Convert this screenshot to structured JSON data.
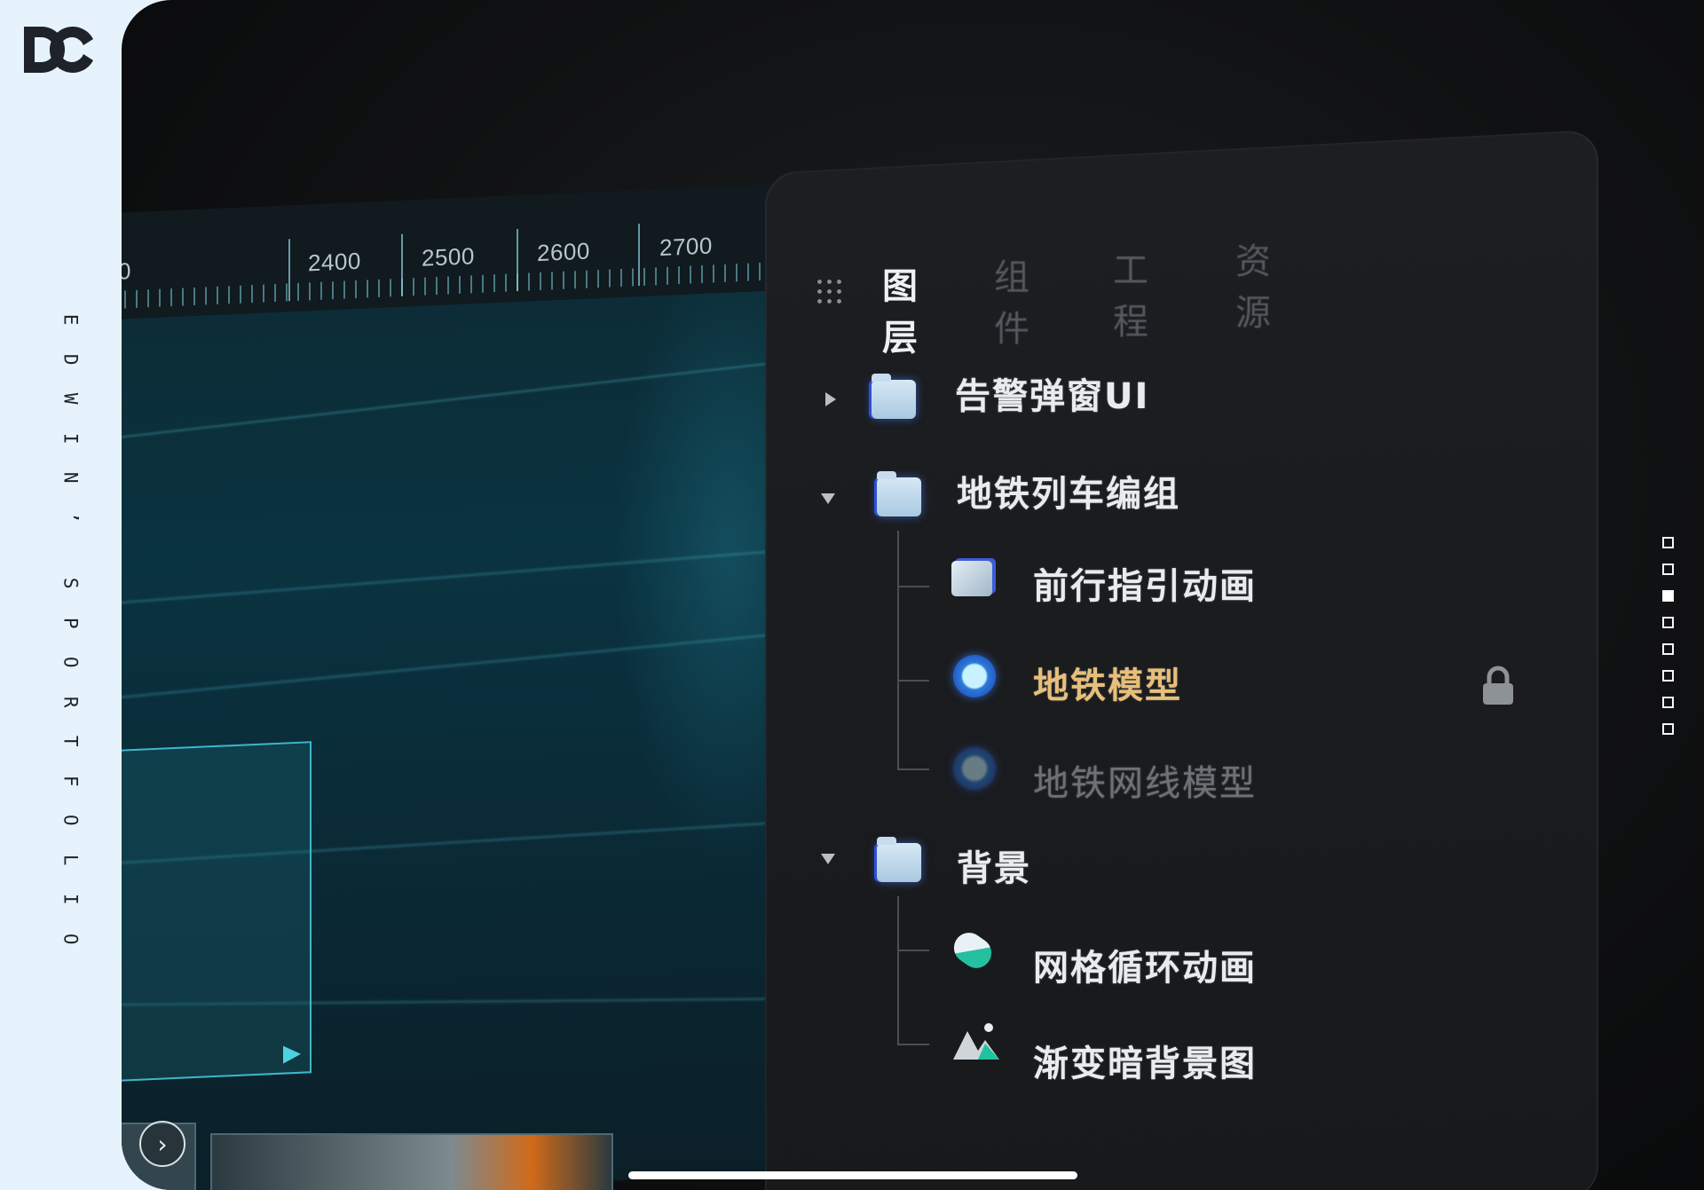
{
  "brand": {
    "logo_text": "DC",
    "logo_icon": "dc-monogram-logo",
    "vertical_title": [
      "E",
      "D",
      "W",
      "I",
      "N",
      "’",
      "S",
      "P",
      "O",
      "R",
      "T",
      "F",
      "O",
      "L",
      "I",
      "O"
    ]
  },
  "ruler": {
    "labels": [
      "0",
      "2400",
      "2500",
      "2600",
      "2700"
    ]
  },
  "layer_panel": {
    "menu_icon": "grid-dots-icon",
    "tabs": [
      {
        "label": "图层",
        "active": true
      },
      {
        "label": "组件",
        "active": false
      },
      {
        "label": "工程",
        "active": false
      },
      {
        "label": "资源",
        "active": false
      }
    ],
    "layers": [
      {
        "label": "告警弹窗UI",
        "icon": "folder-icon",
        "expand": "collapsed",
        "depth": 0
      },
      {
        "label": "地铁列车编组",
        "icon": "folder-icon",
        "expand": "expanded",
        "depth": 0
      },
      {
        "label": "前行指引动画",
        "icon": "cube-icon",
        "depth": 1
      },
      {
        "label": "地铁模型",
        "icon": "sphere-icon",
        "depth": 1,
        "highlighted": true,
        "locked": true
      },
      {
        "label": "地铁网线模型",
        "icon": "sphere-icon",
        "depth": 1,
        "hidden": true
      },
      {
        "label": "背景",
        "icon": "folder-icon",
        "expand": "expanded",
        "depth": 0
      },
      {
        "label": "网格循环动画",
        "icon": "pill-icon",
        "depth": 1
      },
      {
        "label": "渐变暗背景图",
        "icon": "image-icon",
        "depth": 1
      }
    ]
  },
  "pager": {
    "count": 8,
    "active_index": 3
  },
  "colors": {
    "rail_bg": "#e6f3fc",
    "screen_bg": "#101112",
    "accent_cyan": "#3fb7c8",
    "highlight_gold": "#e7bf7a"
  }
}
